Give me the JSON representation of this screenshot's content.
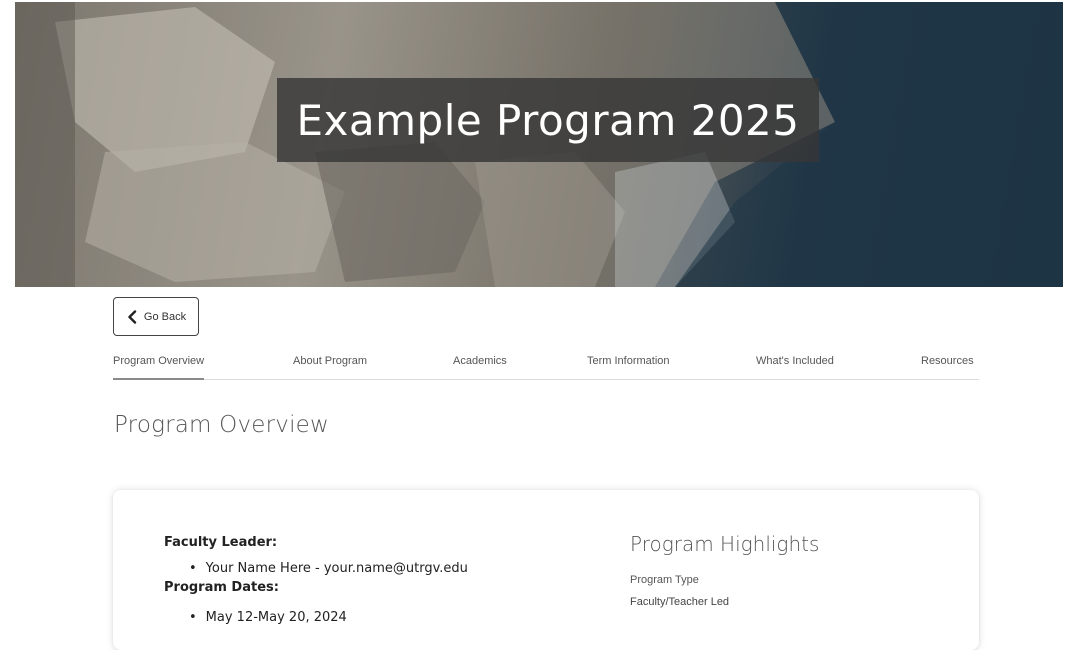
{
  "hero": {
    "title": "Example Program 2025"
  },
  "back_button": {
    "label": "Go Back",
    "icon": "chevron-left-icon"
  },
  "tabs": [
    {
      "label": "Program Overview",
      "active": true
    },
    {
      "label": "About Program",
      "active": false
    },
    {
      "label": "Academics",
      "active": false
    },
    {
      "label": "Term Information",
      "active": false
    },
    {
      "label": "What's Included",
      "active": false
    },
    {
      "label": "Resources",
      "active": false
    }
  ],
  "section_title": "Program Overview",
  "card": {
    "faculty_leader_label": "Faculty Leader:",
    "faculty_leader_items": [
      "Your Name Here - your.name@utrgv.edu"
    ],
    "program_dates_label": "Program Dates:",
    "program_dates_items": [
      "May 12-May 20, 2024"
    ],
    "highlights_title": "Program Highlights",
    "program_type_label": "Program Type",
    "program_type_value": "Faculty/Teacher Led"
  }
}
